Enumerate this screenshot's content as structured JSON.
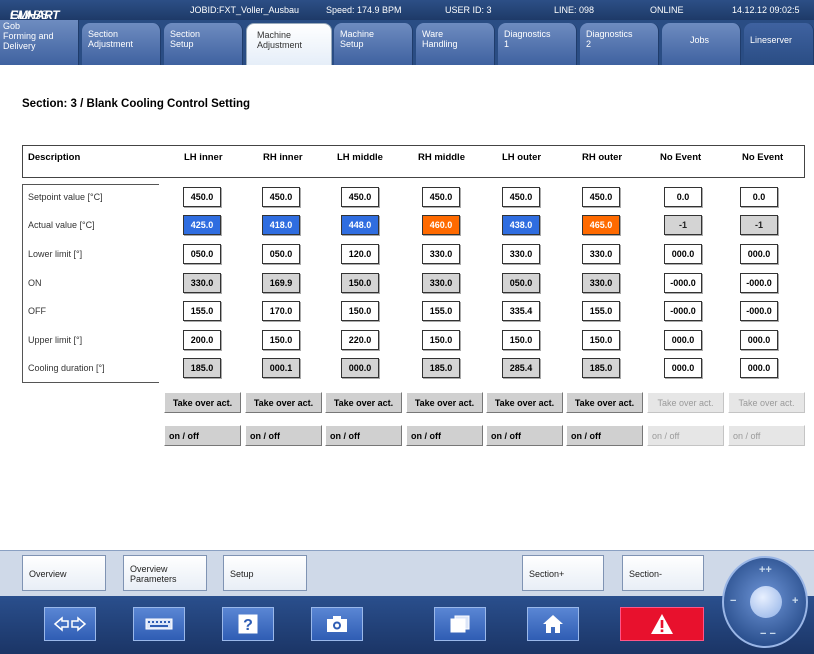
{
  "header": {
    "logo_bold": "EMHART",
    "logo_light": "GLASS",
    "jobid": "JOBID:FXT_Voller_Ausbau",
    "speed": "Speed: 174.9 BPM",
    "user_id": "USER ID: 3",
    "line": "LINE: 098",
    "status": "ONLINE",
    "datetime": "14.12.12 09:02:5"
  },
  "tabs": [
    {
      "label": "Gob\nForming and\nDelivery"
    },
    {
      "label": "Section\nAdjustment"
    },
    {
      "label": "Section\nSetup"
    },
    {
      "label": "Machine\nAdjustment"
    },
    {
      "label": "Machine\nSetup"
    },
    {
      "label": "Ware\nHandling"
    },
    {
      "label": "Diagnostics\n1"
    },
    {
      "label": "Diagnostics\n2"
    },
    {
      "label": "Jobs"
    },
    {
      "label": "Lineserver"
    }
  ],
  "active_tab": "Machine Adjustment",
  "page": {
    "title": "Section: 3 / Blank Cooling Control Setting",
    "description_header": "Description",
    "columns": [
      "LH inner",
      "RH inner",
      "LH middle",
      "RH middle",
      "LH outer",
      "RH outer",
      "No Event",
      "No Event"
    ],
    "row_labels": [
      "Setpoint value [°C]",
      "Actual value [°C]",
      "Lower limit [°]",
      "ON",
      "OFF",
      "Upper limit [°]",
      "Cooling duration [°]"
    ],
    "rows": [
      [
        "450.0",
        "450.0",
        "450.0",
        "450.0",
        "450.0",
        "450.0",
        "0.0",
        "0.0"
      ],
      [
        "425.0",
        "418.0",
        "448.0",
        "460.0",
        "438.0",
        "465.0",
        "-1",
        "-1"
      ],
      [
        "050.0",
        "050.0",
        "120.0",
        "330.0",
        "330.0",
        "330.0",
        "000.0",
        "000.0"
      ],
      [
        "330.0",
        "169.9",
        "150.0",
        "330.0",
        "050.0",
        "330.0",
        "-000.0",
        "-000.0"
      ],
      [
        "155.0",
        "170.0",
        "150.0",
        "155.0",
        "335.4",
        "155.0",
        "-000.0",
        "-000.0"
      ],
      [
        "200.0",
        "150.0",
        "220.0",
        "150.0",
        "150.0",
        "150.0",
        "000.0",
        "000.0"
      ],
      [
        "185.0",
        "000.1",
        "000.0",
        "185.0",
        "285.4",
        "185.0",
        "000.0",
        "000.0"
      ]
    ],
    "take_over_label": "Take over act.",
    "onoff_label": "on / off"
  },
  "lower_buttons": {
    "overview": "Overview",
    "overview_parameters": "Overview\nParameters",
    "setup": "Setup",
    "section_plus": "Section+",
    "section_minus": "Section-"
  },
  "colors": {
    "blue_actual": "#2f6de0",
    "orange_actual": "#ff6a00",
    "alarm_red": "#e8112d",
    "header_blue": "#1e3a68"
  },
  "bottom_icons": [
    "swap-arrows-icon",
    "keyboard-icon",
    "help-icon",
    "camera-icon",
    "window-icon",
    "home-icon",
    "alarm-icon"
  ],
  "dial_icons": [
    "plus-plus-icon",
    "minus-icon",
    "plus-icon",
    "minus-minus-icon"
  ]
}
